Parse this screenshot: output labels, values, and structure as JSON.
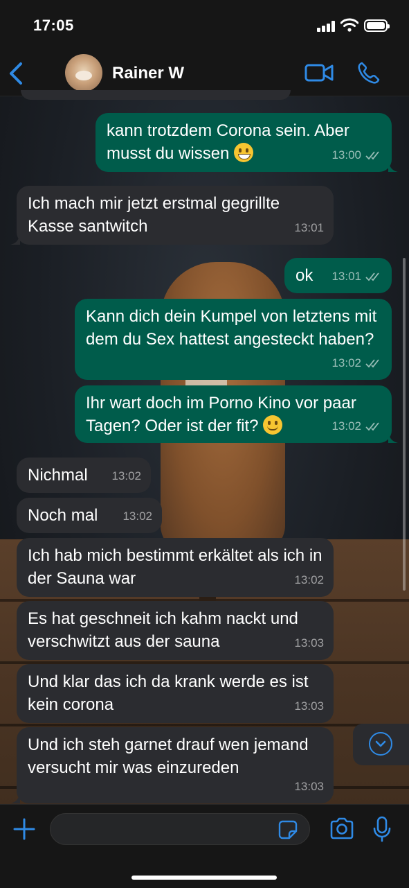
{
  "status": {
    "time": "17:05"
  },
  "header": {
    "contact_name": "Rainer W"
  },
  "colors": {
    "accent": "#2f8ae5",
    "outgoing_bubble": "#005c4b",
    "incoming_bubble": "#2b2c30"
  },
  "messages": [
    {
      "dir": "out",
      "text": "kann trotzdem Corona sein. Aber musst du wissen",
      "emoji": "grinning-face",
      "time": "13:00",
      "read_ticks": true
    },
    {
      "dir": "in",
      "text": "Ich mach mir jetzt erstmal gegrillte Kasse santwitch",
      "time": "13:01"
    },
    {
      "dir": "out",
      "text": "ok",
      "time": "13:01",
      "read_ticks": true
    },
    {
      "dir": "out",
      "text": "Kann dich dein Kumpel von letztens mit dem du Sex hattest angesteckt haben?",
      "time": "13:02",
      "read_ticks": true
    },
    {
      "dir": "out",
      "text": "Ihr wart doch im Porno Kino vor paar Tagen? Oder ist der fit?",
      "emoji": "smiling-face",
      "time": "13:02",
      "read_ticks": true
    },
    {
      "dir": "in",
      "text": "Nichmal",
      "time": "13:02"
    },
    {
      "dir": "in",
      "text": "Noch mal",
      "time": "13:02"
    },
    {
      "dir": "in",
      "text": "Ich hab mich bestimmt erkältet als ich in der Sauna war",
      "time": "13:02"
    },
    {
      "dir": "in",
      "text": "Es hat geschneit ich kahm nackt und verschwitzt aus der sauna",
      "time": "13:03"
    },
    {
      "dir": "in",
      "text": "Und klar das ich da krank werde es ist kein corona",
      "time": "13:03"
    },
    {
      "dir": "in",
      "text": "Und ich steh garnet drauf wen jemand versucht mir was einzureden",
      "time": "13:03"
    }
  ],
  "composer": {
    "placeholder": ""
  },
  "icons": [
    "back-chevron-icon",
    "video-call-icon",
    "phone-icon",
    "plus-icon",
    "sticker-icon",
    "camera-icon",
    "microphone-icon",
    "scroll-down-icon"
  ]
}
